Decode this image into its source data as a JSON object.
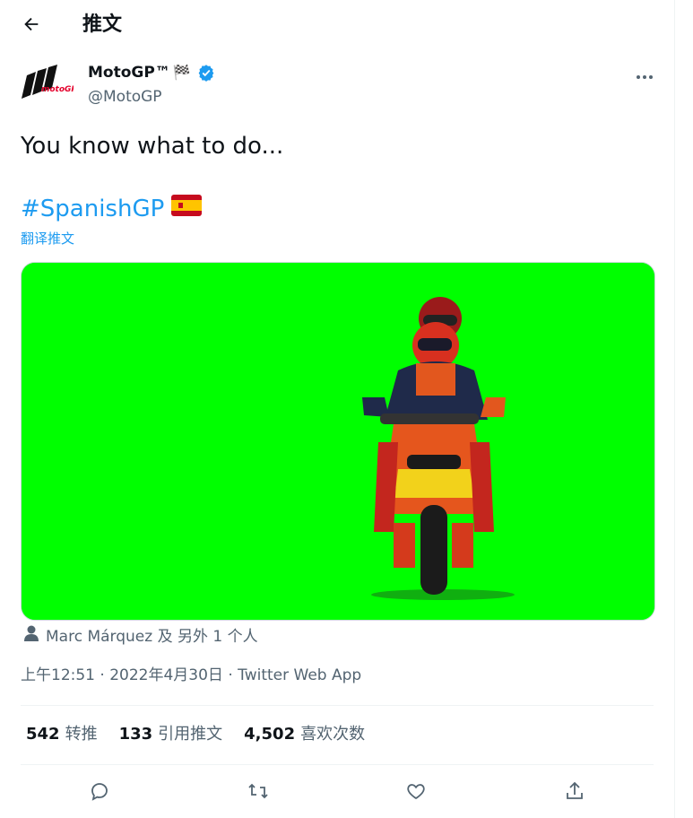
{
  "header": {
    "title": "推文",
    "back_icon": "arrow-left-icon"
  },
  "author": {
    "name": "MotoGP™",
    "flag_emoji": "🏁",
    "handle": "@MotoGP",
    "verified_color": "#1d9bf0",
    "logo_text": "motoGP"
  },
  "tweet": {
    "text": "You know what to do...",
    "hashtag": "#SpanishGP",
    "flag_emoji": "🇪🇸",
    "translate_label": "翻译推文",
    "media_bg": "#00ff00"
  },
  "tagged": {
    "text": "Marc Márquez 及 另外 1 个人"
  },
  "meta": {
    "time": "上午12:51",
    "sep": " · ",
    "date": "2022年4月30日",
    "source": "Twitter Web App"
  },
  "stats": [
    {
      "count": "542",
      "label": "转推"
    },
    {
      "count": "133",
      "label": "引用推文"
    },
    {
      "count": "4,502",
      "label": "喜欢次数"
    }
  ],
  "actions": [
    "reply-icon",
    "retweet-icon",
    "like-icon",
    "share-icon"
  ],
  "colors": {
    "link": "#1d9bf0",
    "secondary": "#536471",
    "primary": "#0f1419"
  }
}
